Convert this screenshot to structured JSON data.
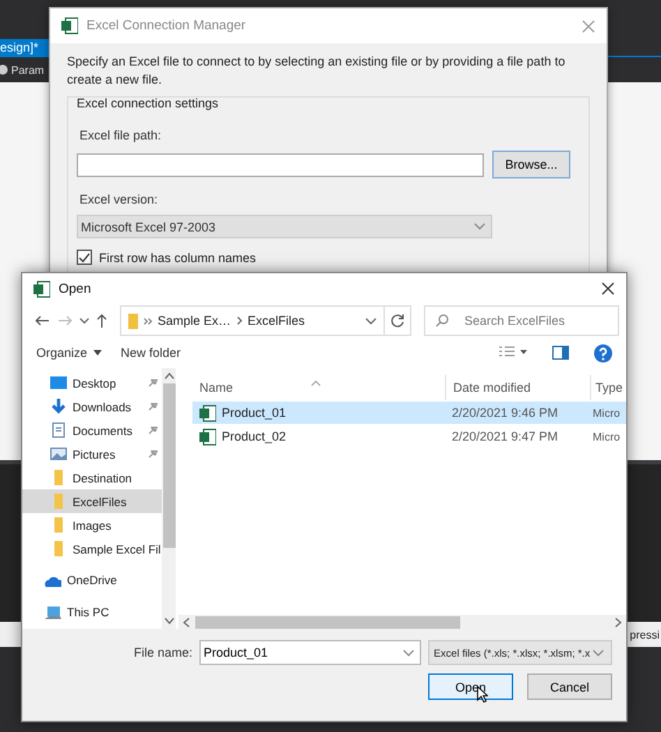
{
  "ide": {
    "tab_label": "esign]*",
    "toolbar_label": "Param",
    "side_label": "pressi"
  },
  "connection_manager": {
    "title": "Excel Connection Manager",
    "description": "Specify an Excel file to connect to by selecting an existing file or by providing a file path to create a new file.",
    "group_title": "Excel connection settings",
    "file_path_label": "Excel file path:",
    "browse_button": "Browse...",
    "version_label": "Excel version:",
    "version_value": "Microsoft Excel 97-2003",
    "first_row_checkbox": {
      "label": "First row has column names",
      "checked": true
    }
  },
  "open_dialog": {
    "title": "Open",
    "breadcrumb": [
      "Sample Ex…",
      "ExcelFiles"
    ],
    "search_placeholder": "Search ExcelFiles",
    "organize": "Organize",
    "new_folder": "New folder",
    "nav_items": [
      {
        "label": "Desktop",
        "kind": "desktop",
        "pinned": true,
        "selected": false
      },
      {
        "label": "Downloads",
        "kind": "downloads",
        "pinned": true,
        "selected": false
      },
      {
        "label": "Documents",
        "kind": "documents",
        "pinned": true,
        "selected": false
      },
      {
        "label": "Pictures",
        "kind": "pictures",
        "pinned": true,
        "selected": false
      },
      {
        "label": "Destination",
        "kind": "folder",
        "pinned": false,
        "selected": false
      },
      {
        "label": "ExcelFiles",
        "kind": "folder",
        "pinned": false,
        "selected": true
      },
      {
        "label": "Images",
        "kind": "folder",
        "pinned": false,
        "selected": false
      },
      {
        "label": "Sample Excel Fil",
        "kind": "folder",
        "pinned": false,
        "selected": false
      },
      {
        "label": "OneDrive",
        "kind": "onedrive",
        "pinned": false,
        "selected": false
      },
      {
        "label": "This PC",
        "kind": "pc",
        "pinned": false,
        "selected": false
      }
    ],
    "columns": [
      "Name",
      "Date modified",
      "Type"
    ],
    "files": [
      {
        "name": "Product_01",
        "date": "2/20/2021 9:46 PM",
        "type": "Micro",
        "selected": true
      },
      {
        "name": "Product_02",
        "date": "2/20/2021 9:47 PM",
        "type": "Micro",
        "selected": false
      }
    ],
    "file_name_label": "File name:",
    "file_name_value": "Product_01",
    "file_type": "Excel files (*.xls; *.xlsx; *.xlsm; *.x",
    "buttons": [
      "Open",
      "Cancel"
    ]
  }
}
